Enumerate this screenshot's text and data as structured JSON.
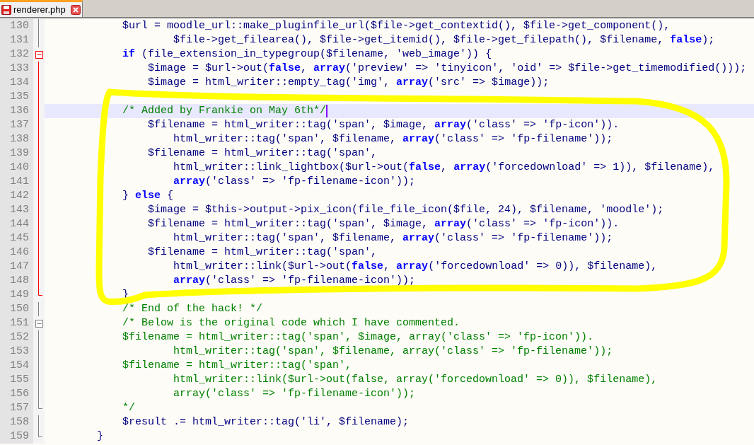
{
  "tabs": [
    {
      "label": "renderer.php",
      "selected": true,
      "modified": true
    }
  ],
  "lines": [
    {
      "number": "130",
      "kind": "code",
      "fold": {
        "kind": "body",
        "active": false
      },
      "current": false,
      "text": "            $url = moodle_url::make_pluginfile_url($file->get_contextid(), $file->get_component(),"
    },
    {
      "number": "131",
      "kind": "code",
      "fold": {
        "kind": "body",
        "active": false
      },
      "current": false,
      "text": "                    $file->get_filearea(), $file->get_itemid(), $file->get_filepath(), $filename, **false**);"
    },
    {
      "number": "132",
      "kind": "code",
      "fold": {
        "kind": "start",
        "active": true
      },
      "current": false,
      "text": "            **if** (file_extension_in_typegroup($filename, 'web_image')) {"
    },
    {
      "number": "133",
      "kind": "code",
      "fold": {
        "kind": "body",
        "active": true
      },
      "current": false,
      "text": "                $image = $url->out(**false**, **array**('preview' => 'tinyicon', 'oid' => $file->get_timemodified()));"
    },
    {
      "number": "134",
      "kind": "code",
      "fold": {
        "kind": "body",
        "active": true
      },
      "current": false,
      "text": "                $image = html_writer::empty_tag('img', **array**('src' => $image));"
    },
    {
      "number": "135",
      "fold": {
        "kind": "body",
        "active": true
      },
      "current": false
    },
    {
      "number": "136",
      "kind": "comment",
      "fold": {
        "kind": "body",
        "active": true
      },
      "current": true,
      "text": "            /* Added by Frankie on May 6th*/"
    },
    {
      "number": "137",
      "kind": "code",
      "fold": {
        "kind": "body",
        "active": true
      },
      "current": false,
      "text": "                $filename = html_writer::tag('span', $image, **array**('class' => 'fp-icon'))."
    },
    {
      "number": "138",
      "kind": "code",
      "fold": {
        "kind": "body",
        "active": true
      },
      "current": false,
      "text": "                    html_writer::tag('span', $filename, **array**('class' => 'fp-filename'));"
    },
    {
      "number": "139",
      "kind": "code",
      "fold": {
        "kind": "body",
        "active": true
      },
      "current": false,
      "text": "                $filename = html_writer::tag('span',"
    },
    {
      "number": "140",
      "kind": "code",
      "fold": {
        "kind": "body",
        "active": true
      },
      "current": false,
      "text": "                    html_writer::link_lightbox($url->out(**false**, **array**('forcedownload' => 1)), $filename),"
    },
    {
      "number": "141",
      "kind": "code",
      "fold": {
        "kind": "body",
        "active": true
      },
      "current": false,
      "text": "                    **array**('class' => 'fp-filename-icon'));"
    },
    {
      "number": "142",
      "kind": "code",
      "fold": {
        "kind": "body",
        "active": true
      },
      "current": false,
      "text": "            } **else** {"
    },
    {
      "number": "143",
      "kind": "code",
      "fold": {
        "kind": "body",
        "active": true
      },
      "current": false,
      "text": "                $image = $this->output->pix_icon(file_file_icon($file, 24), $filename, 'moodle');"
    },
    {
      "number": "144",
      "kind": "code",
      "fold": {
        "kind": "body",
        "active": true
      },
      "current": false,
      "text": "                $filename = html_writer::tag('span', $image, **array**('class' => 'fp-icon'))."
    },
    {
      "number": "145",
      "kind": "code",
      "fold": {
        "kind": "body",
        "active": true
      },
      "current": false,
      "text": "                    html_writer::tag('span', $filename, **array**('class' => 'fp-filename'));"
    },
    {
      "number": "146",
      "kind": "code",
      "fold": {
        "kind": "body",
        "active": true
      },
      "current": false,
      "text": "                $filename = html_writer::tag('span',"
    },
    {
      "number": "147",
      "kind": "code",
      "fold": {
        "kind": "body",
        "active": true
      },
      "current": false,
      "text": "                    html_writer::link($url->out(**false**, **array**('forcedownload' => 0)), $filename),"
    },
    {
      "number": "148",
      "kind": "code",
      "fold": {
        "kind": "body",
        "active": true
      },
      "current": false,
      "text": "                    **array**('class' => 'fp-filename-icon'));"
    },
    {
      "number": "149",
      "kind": "code",
      "fold": {
        "kind": "end",
        "active": true
      },
      "current": false,
      "text": "            }"
    },
    {
      "number": "150",
      "kind": "comment",
      "fold": {
        "kind": "body",
        "active": false
      },
      "current": false,
      "text": "            /* End of the hack! */"
    },
    {
      "number": "151",
      "kind": "comment",
      "fold": {
        "kind": "start",
        "active": false
      },
      "current": false,
      "text": "            /* Below is the original code which I have commented."
    },
    {
      "number": "152",
      "kind": "comment",
      "fold": {
        "kind": "body",
        "active": false
      },
      "current": false,
      "text": "            $filename = html_writer::tag('span', $image, array('class' => 'fp-icon'))."
    },
    {
      "number": "153",
      "kind": "comment",
      "fold": {
        "kind": "body",
        "active": false
      },
      "current": false,
      "text": "                    html_writer::tag('span', $filename, array('class' => 'fp-filename'));"
    },
    {
      "number": "154",
      "kind": "comment",
      "fold": {
        "kind": "body",
        "active": false
      },
      "current": false,
      "text": "            $filename = html_writer::tag('span',"
    },
    {
      "number": "155",
      "kind": "comment",
      "fold": {
        "kind": "body",
        "active": false
      },
      "current": false,
      "text": "                    html_writer::link($url->out(false, array('forcedownload' => 0)), $filename),"
    },
    {
      "number": "156",
      "kind": "comment",
      "fold": {
        "kind": "body",
        "active": false
      },
      "current": false,
      "text": "                    array('class' => 'fp-filename-icon'));"
    },
    {
      "number": "157",
      "kind": "comment",
      "fold": {
        "kind": "end",
        "active": false
      },
      "current": false,
      "text": "            */"
    },
    {
      "number": "158",
      "kind": "code",
      "fold": {
        "kind": "body",
        "active": false
      },
      "current": false,
      "text": "            $result .= html_writer::tag('li', $filename);"
    },
    {
      "number": "159",
      "kind": "code",
      "fold": {
        "kind": "end",
        "active": false
      },
      "current": false,
      "text": "        }"
    }
  ]
}
